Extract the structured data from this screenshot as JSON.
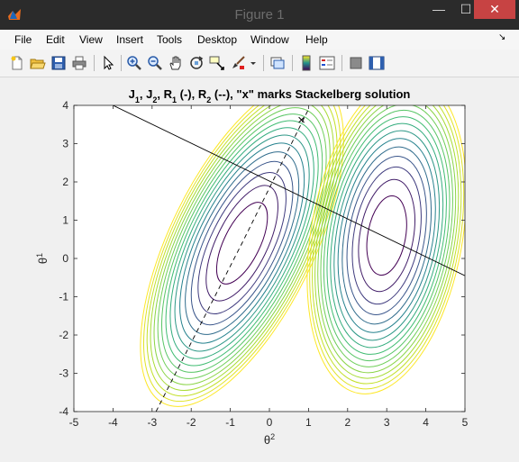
{
  "window": {
    "title": "Figure 1",
    "minimize_glyph": "—",
    "maximize_glyph": "☐",
    "close_glyph": "✕"
  },
  "menu": {
    "items": [
      "File",
      "Edit",
      "View",
      "Insert",
      "Tools",
      "Desktop",
      "Window",
      "Help"
    ],
    "dock_glyph": "↘"
  },
  "toolbar": {
    "icons": [
      "new-figure-icon",
      "open-file-icon",
      "save-icon",
      "print-icon",
      "pointer-icon",
      "zoom-in-icon",
      "zoom-out-icon",
      "pan-icon",
      "rotate-3d-icon",
      "data-cursor-icon",
      "brush-icon",
      "brush-dropdown-icon",
      "link-plot-icon",
      "colorbar-icon",
      "legend-icon",
      "hide-plot-tools-icon",
      "show-plot-tools-icon"
    ]
  },
  "chart_data": {
    "type": "contour",
    "title": "J1, J2, R1 (-), R2 (--), \"x\" marks Stackelberg solution",
    "xlabel": "θ2",
    "ylabel": "θ1",
    "xlim": [
      -5,
      5
    ],
    "ylim": [
      -4,
      4
    ],
    "xticks": [
      -5,
      -4,
      -3,
      -2,
      -1,
      0,
      1,
      2,
      3,
      4,
      5
    ],
    "yticks": [
      -4,
      -3,
      -2,
      -1,
      0,
      1,
      2,
      3,
      4
    ],
    "colormap": [
      "#440154",
      "#3e4a89",
      "#26828e",
      "#35b779",
      "#6ece58",
      "#b5de2b",
      "#fde725"
    ],
    "J1": {
      "center": [
        -0.7,
        0.4
      ],
      "levels": 16,
      "orientation": "tilted"
    },
    "J2": {
      "center": [
        3.0,
        0.6
      ],
      "levels": 16,
      "orientation": "upright"
    },
    "R1": {
      "style": "solid",
      "x": [
        -4.0,
        5.0
      ],
      "y": [
        4.0,
        -0.45
      ]
    },
    "R2": {
      "style": "dashed",
      "x": [
        -2.9,
        -0.7,
        1.0
      ],
      "y": [
        -4.0,
        0.4,
        3.9
      ]
    },
    "stackelberg": {
      "marker": "x",
      "x": 0.82,
      "y": 3.62
    },
    "grid": false
  }
}
